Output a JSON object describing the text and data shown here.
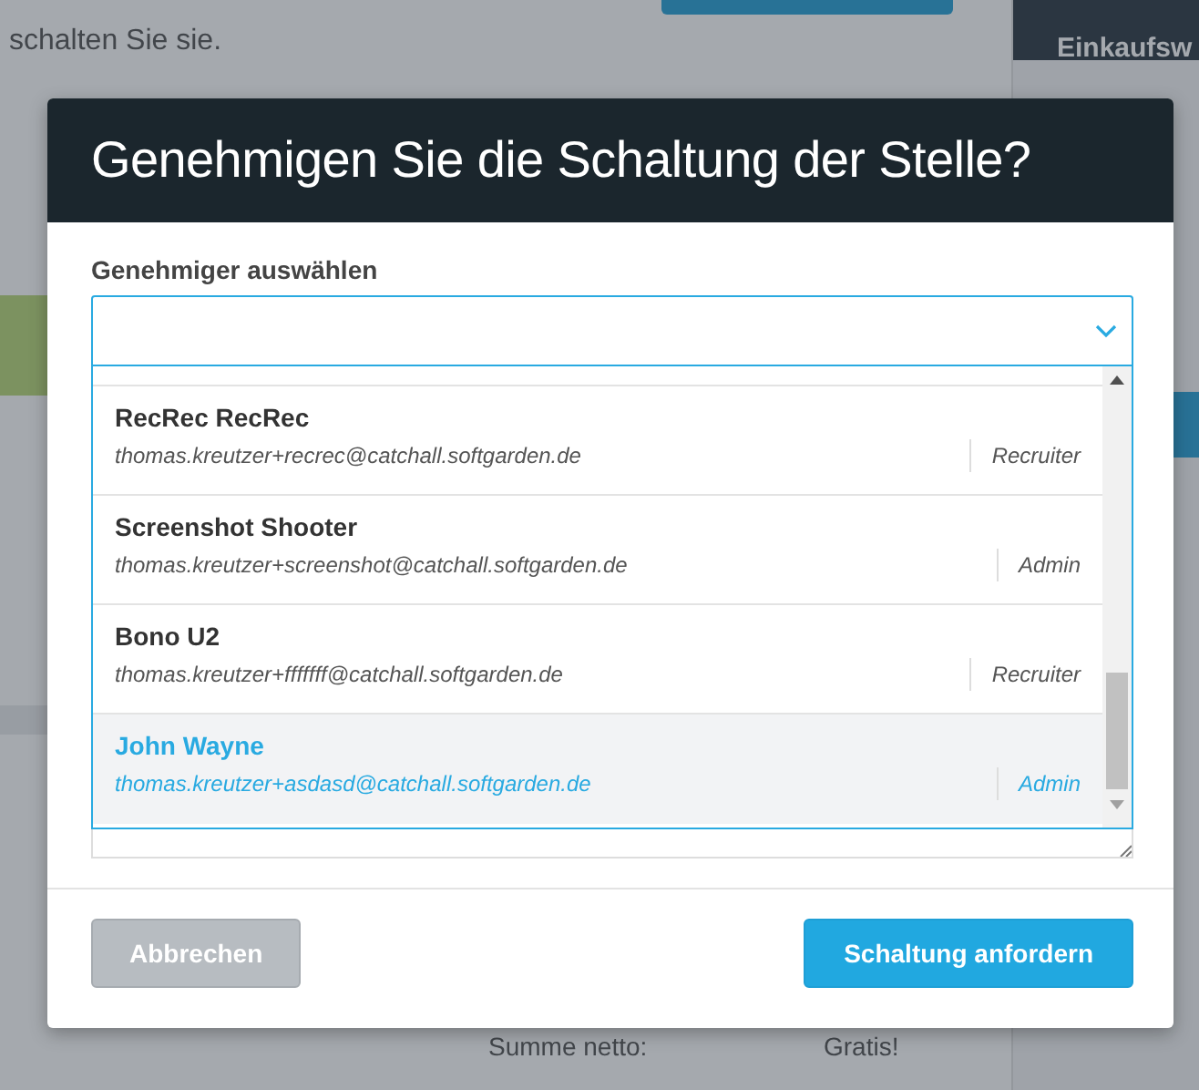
{
  "background": {
    "intro_text": "schalten Sie sie.",
    "sidebar": {
      "header": "Einkaufsw"
    },
    "summary": [
      {
        "label": "Summe netto:",
        "value": "Gratis!"
      }
    ]
  },
  "dialog": {
    "title": "Genehmigen Sie die Schaltung der Stelle?",
    "field_label": "Genehmiger auswählen",
    "options": [
      {
        "name": "RecRec RecRec",
        "email": "thomas.kreutzer+recrec@catchall.softgarden.de",
        "role": "Recruiter",
        "selected": false
      },
      {
        "name": "Screenshot Shooter",
        "email": "thomas.kreutzer+screenshot@catchall.softgarden.de",
        "role": "Admin",
        "selected": false
      },
      {
        "name": "Bono U2",
        "email": "thomas.kreutzer+fffffff@catchall.softgarden.de",
        "role": "Recruiter",
        "selected": false
      },
      {
        "name": "John Wayne",
        "email": "thomas.kreutzer+asdasd@catchall.softgarden.de",
        "role": "Admin",
        "selected": true
      }
    ],
    "buttons": [
      {
        "label": "Abbrechen",
        "kind": "secondary"
      },
      {
        "label": "Schaltung anfordern",
        "kind": "primary"
      }
    ]
  }
}
